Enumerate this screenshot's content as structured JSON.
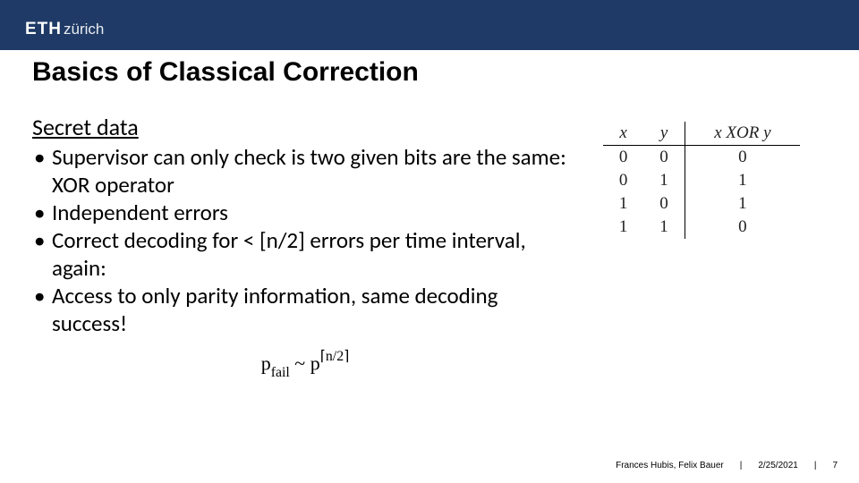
{
  "header": {
    "logo_bold": "ETH",
    "logo_light": "zürich"
  },
  "title": "Basics of Classical Correction",
  "content": {
    "subhead": "Secret data",
    "bullets": [
      "Supervisor can only check is two given bits are the same: XOR operator",
      "Independent errors",
      "Correct decoding for < [n/2] errors per time interval, again:",
      "Access to only parity information, same decoding success!"
    ]
  },
  "formula": {
    "p": "p",
    "fail_sub": "fail",
    "tilde": " ~ ",
    "p2": "p",
    "exp": "⌈n/2⌉"
  },
  "xor_table": {
    "headers": [
      "x",
      "y",
      "x XOR y"
    ],
    "rows": [
      [
        "0",
        "0",
        "0"
      ],
      [
        "0",
        "1",
        "1"
      ],
      [
        "1",
        "0",
        "1"
      ],
      [
        "1",
        "1",
        "0"
      ]
    ]
  },
  "footer": {
    "authors": "Frances Hubis, Felix Bauer",
    "sep": "|",
    "date": "2/25/2021",
    "page": "7"
  }
}
